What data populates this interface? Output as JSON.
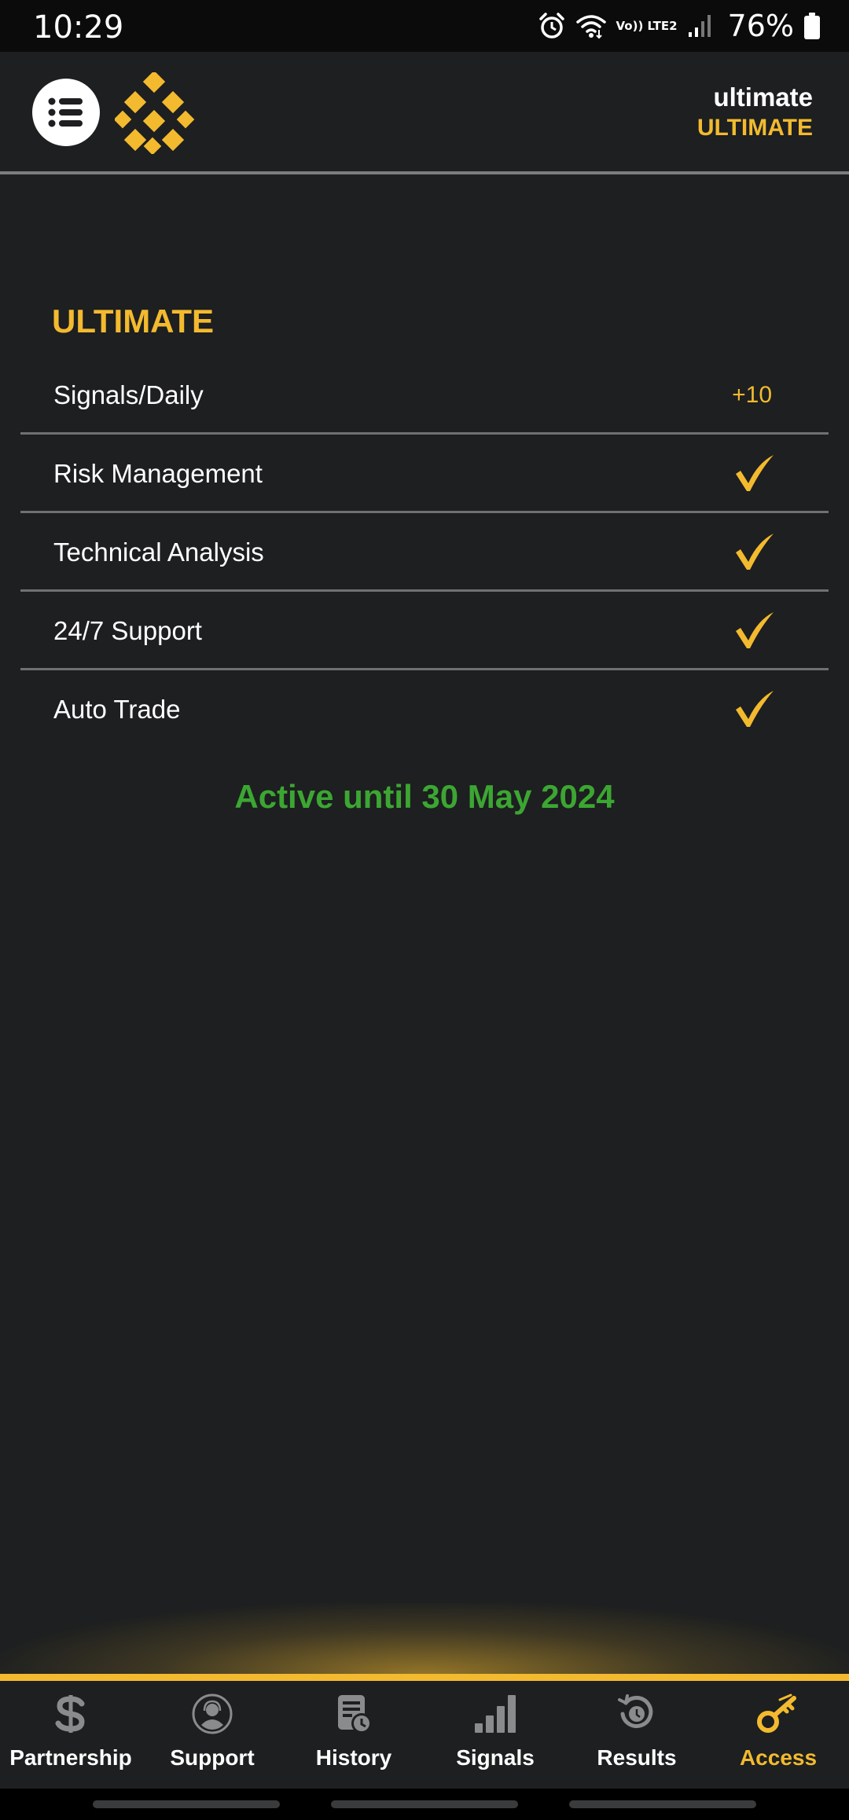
{
  "status_bar": {
    "time": "10:29",
    "battery": "76%",
    "network_label": "Vo)) LTE2",
    "icons": [
      "alarm-icon",
      "wifi-icon",
      "lte-icon",
      "signal-icon",
      "battery-icon"
    ]
  },
  "header": {
    "menu_icon": "list-icon",
    "logo_icon": "brand-logo",
    "user_name": "ultimate",
    "user_level": "ULTIMATE"
  },
  "plan": {
    "title": "ULTIMATE",
    "features": [
      {
        "label": "Signals/Daily",
        "value": "+10"
      },
      {
        "label": "Risk Management",
        "value": null,
        "icon": "check-icon"
      },
      {
        "label": "Technical Analysis",
        "value": null,
        "icon": "check-icon"
      },
      {
        "label": "24/7 Support",
        "value": null,
        "icon": "check-icon"
      },
      {
        "label": "Auto Trade",
        "value": null,
        "icon": "check-icon"
      }
    ],
    "active_until": "Active until 30 May 2024"
  },
  "bottom_nav": {
    "items": [
      {
        "label": "Partnership",
        "icon": "dollar-icon"
      },
      {
        "label": "Support",
        "icon": "support-agent-icon"
      },
      {
        "label": "History",
        "icon": "history-icon"
      },
      {
        "label": "Signals",
        "icon": "signal-bars-icon"
      },
      {
        "label": "Results",
        "icon": "results-icon"
      },
      {
        "label": "Access",
        "icon": "key-icon",
        "active": true
      }
    ]
  },
  "colors": {
    "background": "#1d1f20",
    "accent": "#f3ba2f",
    "success": "#3ca632",
    "divider": "#6f7072",
    "icon_inactive": "#8a8b8d"
  }
}
